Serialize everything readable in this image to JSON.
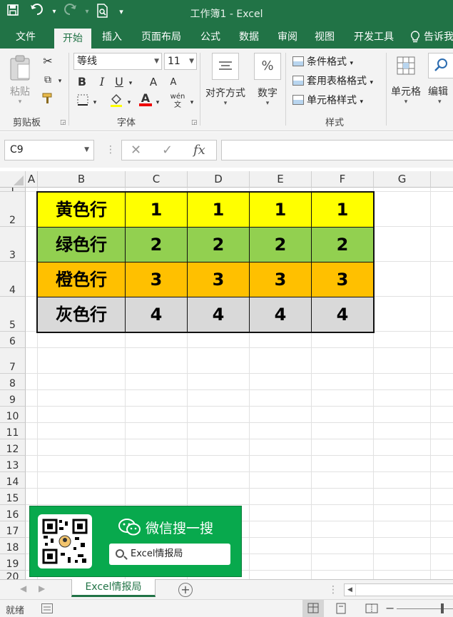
{
  "window": {
    "title": "工作簿1 - Excel"
  },
  "quick_access": {
    "save": "save-icon",
    "undo": "undo-icon",
    "redo": "redo-icon",
    "print_preview": "print-preview-icon"
  },
  "tabs": [
    "文件",
    "开始",
    "插入",
    "页面布局",
    "公式",
    "数据",
    "审阅",
    "视图",
    "开发工具",
    "告诉我"
  ],
  "active_tab": "开始",
  "ribbon": {
    "clipboard": {
      "paste": "粘贴",
      "group": "剪贴板"
    },
    "font": {
      "name": "等线",
      "size": "11",
      "bold": "B",
      "italic": "I",
      "underline": "U",
      "grow": "A",
      "shrink": "A",
      "font_color": "A",
      "phonetic": "wén",
      "group": "字体"
    },
    "alignment": {
      "label": "对齐方式"
    },
    "number": {
      "label": "数字",
      "symbol": "%"
    },
    "styles": {
      "conditional": "条件格式",
      "table": "套用表格格式",
      "cell_styles": "单元格样式",
      "group": "样式"
    },
    "cells": {
      "label": "单元格"
    },
    "editing": {
      "label": "编辑"
    }
  },
  "formula_bar": {
    "name_box": "C9",
    "fx": "fx",
    "formula": ""
  },
  "columns": [
    "A",
    "B",
    "C",
    "D",
    "E",
    "F",
    "G"
  ],
  "rows": [
    "1",
    "2",
    "3",
    "4",
    "5",
    "6",
    "7",
    "8",
    "9",
    "10",
    "11",
    "12",
    "13",
    "14",
    "15",
    "16",
    "17",
    "18",
    "19",
    "20"
  ],
  "table": [
    {
      "label": "黄色行",
      "values": [
        "1",
        "1",
        "1",
        "1"
      ],
      "color": "#ffff00"
    },
    {
      "label": "绿色行",
      "values": [
        "2",
        "2",
        "2",
        "2"
      ],
      "color": "#92d050"
    },
    {
      "label": "橙色行",
      "values": [
        "3",
        "3",
        "3",
        "3"
      ],
      "color": "#ffc000"
    },
    {
      "label": "灰色行",
      "values": [
        "4",
        "4",
        "4",
        "4"
      ],
      "color": "#d9d9d9"
    }
  ],
  "promo": {
    "title": "微信搜一搜",
    "search_text": "Excel情报局",
    "accent": "#08a94d"
  },
  "sheet_tab": "Excel情报局",
  "status": {
    "ready": "就绪"
  },
  "colors": {
    "excel_green": "#217346"
  }
}
